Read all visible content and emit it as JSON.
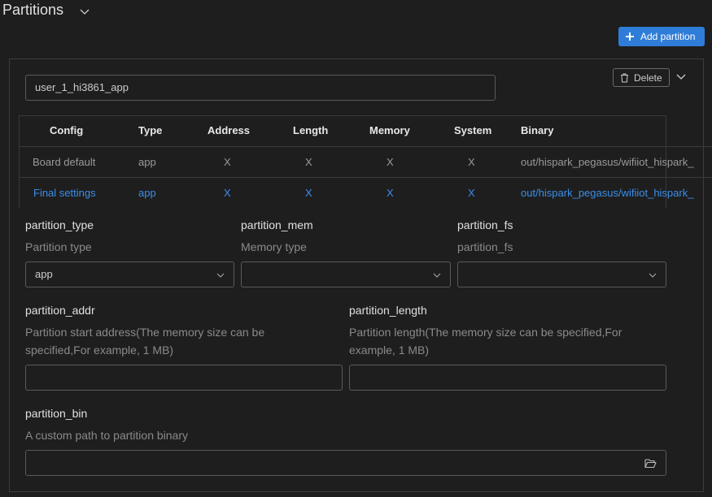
{
  "header": {
    "title": "Partitions",
    "add_button_label": "Add partition"
  },
  "partition": {
    "name": "user_1_hi3861_app",
    "delete_label": "Delete"
  },
  "table": {
    "columns": [
      "Config",
      "Type",
      "Address",
      "Length",
      "Memory",
      "System",
      "Binary"
    ],
    "rows": [
      {
        "config": "Board default",
        "type": "app",
        "address": "X",
        "length": "X",
        "memory": "X",
        "system": "X",
        "binary": "out/hispark_pegasus/wifiiot_hispark_"
      },
      {
        "config": "Final settings",
        "type": "app",
        "address": "X",
        "length": "X",
        "memory": "X",
        "system": "X",
        "binary": "out/hispark_pegasus/wifiiot_hispark_"
      }
    ]
  },
  "fields": {
    "partition_type": {
      "label": "partition_type",
      "description": "Partition type",
      "value": "app"
    },
    "partition_mem": {
      "label": "partition_mem",
      "description": "Memory type",
      "value": ""
    },
    "partition_fs": {
      "label": "partition_fs",
      "description": "partition_fs",
      "value": ""
    },
    "partition_addr": {
      "label": "partition_addr",
      "description": "Partition start address(The memory size can be specified,For example, 1 MB)",
      "value": ""
    },
    "partition_length": {
      "label": "partition_length",
      "description": "Partition length(The memory size can be specified,For example, 1 MB)",
      "value": ""
    },
    "partition_bin": {
      "label": "partition_bin",
      "description": "A custom path to partition binary",
      "value": ""
    }
  },
  "colors": {
    "background": "#1e1e1e",
    "accent": "#2f7dd8",
    "link": "#3b8eea",
    "border": "#5a5a5a"
  },
  "icons": [
    "chevron-down-icon",
    "plus-icon",
    "trash-icon",
    "folder-open-icon"
  ]
}
